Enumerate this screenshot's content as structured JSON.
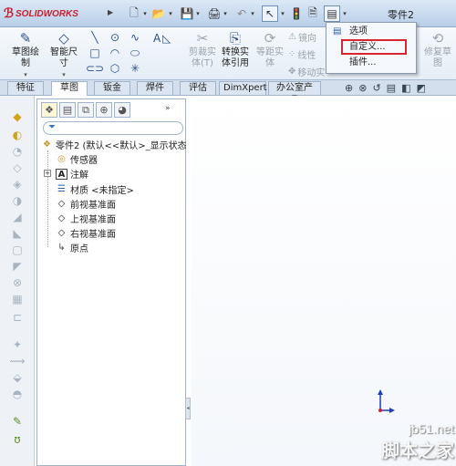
{
  "app": {
    "brand": "SOLIDWORKS",
    "document_title": "零件2"
  },
  "command_manager": {
    "sketch_label": "草图绘\n制",
    "smart_dim_label": "智能尺\n寸",
    "trim_label": "剪裁实\n体(T)",
    "convert_label": "转换实\n体引用",
    "offset_label": "等距实\n体",
    "mirror_label": "镜向",
    "linear_label": "线性",
    "move_label": "移动实",
    "repair_label": "修复草\n图"
  },
  "tabs": [
    {
      "label": "特征"
    },
    {
      "label": "草图"
    },
    {
      "label": "钣金"
    },
    {
      "label": "焊件"
    },
    {
      "label": "评估"
    },
    {
      "label": "DimXpert"
    },
    {
      "label": "办公室产品"
    }
  ],
  "active_tab": "草图",
  "dropdown_menu": {
    "items": [
      {
        "label": "选项"
      },
      {
        "label": "自定义..."
      },
      {
        "label": "插件..."
      }
    ],
    "highlighted": "自定义..."
  },
  "feature_tree": {
    "root": "零件2 (默认<<默认>_显示状态",
    "items": [
      {
        "label": "传感器",
        "icon": "sensor-icon"
      },
      {
        "label": "注解",
        "icon": "annotation-icon"
      },
      {
        "label": "材质 <未指定>",
        "icon": "material-icon"
      },
      {
        "label": "前视基准面",
        "icon": "plane-icon"
      },
      {
        "label": "上视基准面",
        "icon": "plane-icon"
      },
      {
        "label": "右视基准面",
        "icon": "plane-icon"
      },
      {
        "label": "原点",
        "icon": "origin-icon"
      }
    ]
  },
  "watermark": {
    "url": "jb51.net",
    "name": "脚本之家"
  }
}
